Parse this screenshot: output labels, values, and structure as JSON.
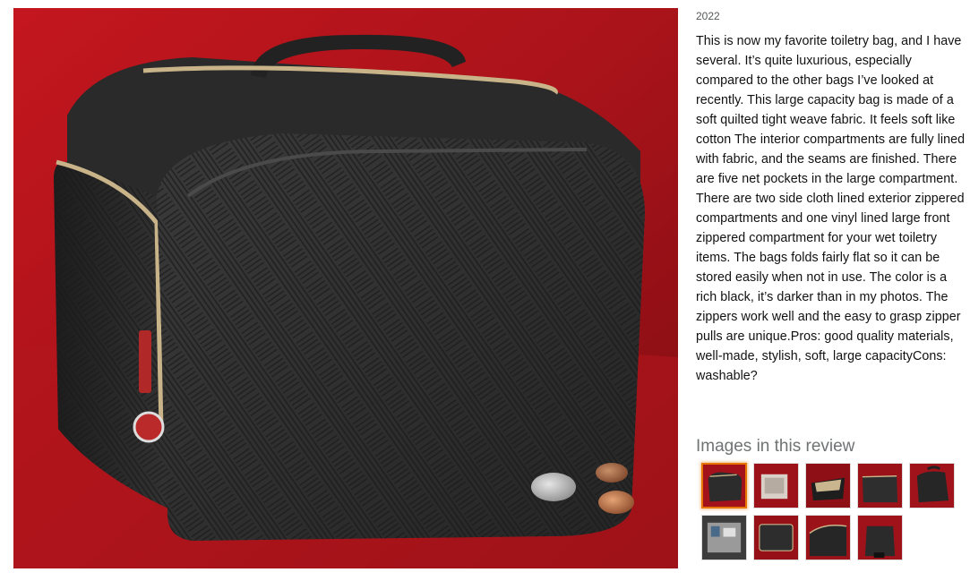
{
  "review": {
    "date": "2022",
    "body": "This is now my favorite toiletry bag, and I have several. It’s quite luxurious, especially compared to the other bags I’ve looked at recently. This large capacity bag is made of a soft quilted tight weave fabric. It feels soft like cotton The interior compartments are fully lined with fabric, and the seams are finished. There are five net pockets in the large compartment. There are two side cloth lined exterior zippered compartments and one vinyl lined large front zippered compartment for your wet toiletry items. The bags folds fairly flat so it can be stored easily when not in use. The color is a rich black, it’s darker than in my photos. The zippers work well and the easy to grasp zipper pulls are unique.Pros: good quality materials, well-made, stylish, soft, large capacityCons: washable?"
  },
  "gallery": {
    "heading": "Images in this review",
    "thumbnails": [
      {
        "name": "thumbnail-1",
        "active": true
      },
      {
        "name": "thumbnail-2",
        "active": false
      },
      {
        "name": "thumbnail-3",
        "active": false
      },
      {
        "name": "thumbnail-4",
        "active": false
      },
      {
        "name": "thumbnail-5",
        "active": false
      },
      {
        "name": "thumbnail-6",
        "active": false
      },
      {
        "name": "thumbnail-7",
        "active": false
      },
      {
        "name": "thumbnail-8",
        "active": false
      },
      {
        "name": "thumbnail-9",
        "active": false
      }
    ]
  },
  "colors": {
    "active_thumb_border": "#e77600",
    "heading_gray": "#6f7373",
    "couch_red": "#a8121a",
    "bag_black": "#2b2b2b"
  }
}
